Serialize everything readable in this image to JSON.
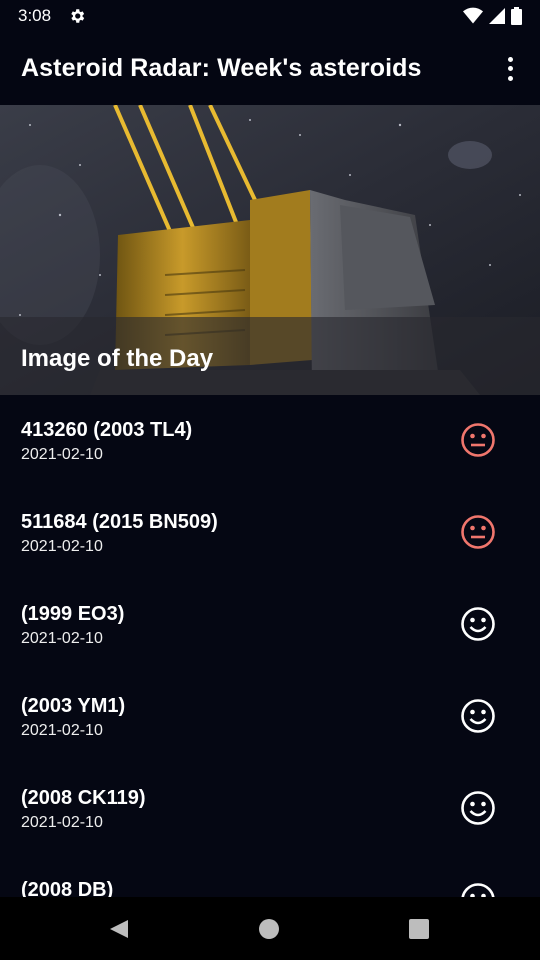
{
  "status_bar": {
    "time": "3:08",
    "icons": [
      "gear-icon",
      "wifi-icon",
      "cell-signal-icon",
      "battery-icon"
    ]
  },
  "app_bar": {
    "title": "Asteroid Radar: Week's asteroids",
    "menu_icon": "overflow-menu-icon"
  },
  "image_of_day": {
    "caption": "Image of the Day"
  },
  "asteroids": [
    {
      "name": "413260 (2003 TL4)",
      "date": "2021-02-10",
      "hazardous": true
    },
    {
      "name": "511684 (2015 BN509)",
      "date": "2021-02-10",
      "hazardous": true
    },
    {
      "name": "(1999 EO3)",
      "date": "2021-02-10",
      "hazardous": false
    },
    {
      "name": "(2003 YM1)",
      "date": "2021-02-10",
      "hazardous": false
    },
    {
      "name": "(2008 CK119)",
      "date": "2021-02-10",
      "hazardous": false
    },
    {
      "name": "(2008 DB)",
      "date": "",
      "hazardous": false
    }
  ],
  "colors": {
    "background": "#050713",
    "hazardous": "#f0766d",
    "safe": "#ffffff"
  },
  "nav_bar": {
    "icons": [
      "back-icon",
      "home-icon",
      "recents-icon"
    ]
  }
}
